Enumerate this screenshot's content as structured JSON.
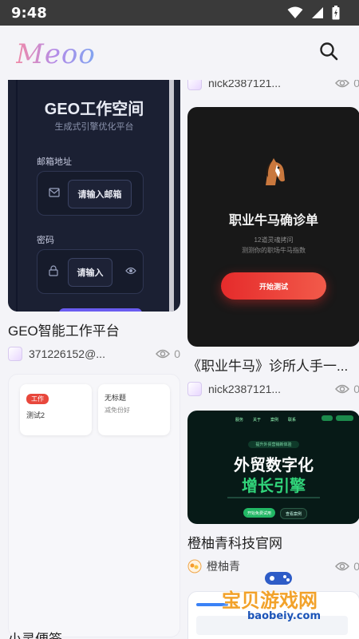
{
  "status_bar": {
    "time": "9:48"
  },
  "app": {
    "logo": "Meoo"
  },
  "left_column": [
    {
      "thumb": {
        "heading": "GEO工作空间",
        "subheading": "生成式引擎优化平台",
        "email_label": "邮箱地址",
        "email_placeholder": "请输入邮箱",
        "password_label": "密码",
        "password_placeholder": "请输入"
      },
      "title": "GEO智能工作平台",
      "author": "371226152@...",
      "views": "0"
    },
    {
      "thumb": {
        "card1_tag": "工作",
        "card1_text": "测试2",
        "card2_title": "无标题",
        "card2_text": "减免份好"
      },
      "title": "小灵便签"
    }
  ],
  "right_column": [
    {
      "author": "nick2387121...",
      "views": "0"
    },
    {
      "thumb": {
        "heading": "职业牛马确诊单",
        "line1": "12道灵魂拷问",
        "line2": "测测你的职场牛马指数",
        "button": "开始测试"
      },
      "title": "《职业牛马》诊所人手一...",
      "author": "nick2387121...",
      "views": "0"
    },
    {
      "thumb": {
        "nav": [
          "服务",
          "关于",
          "案例",
          "联系"
        ],
        "badge": "提升外贸营销新体验",
        "heading1": "外贸数字化",
        "heading2": "增长引擎",
        "btn_primary": "开始免费试用",
        "btn_secondary": "查看案例"
      },
      "title": "橙柚青科技官网",
      "author": "橙柚青",
      "views": "0"
    }
  ],
  "watermark": {
    "text": "宝贝游戏网",
    "url": "baobeiy.com"
  },
  "colors": {
    "accent": "#6a5cf0",
    "geo_bg": "#1b2033",
    "mamu_bg": "#181818",
    "mamu_btn": "#e52b2b",
    "tech_bg": "#071a17",
    "tech_green": "#31d47a",
    "note_tag": "#e8473c"
  }
}
